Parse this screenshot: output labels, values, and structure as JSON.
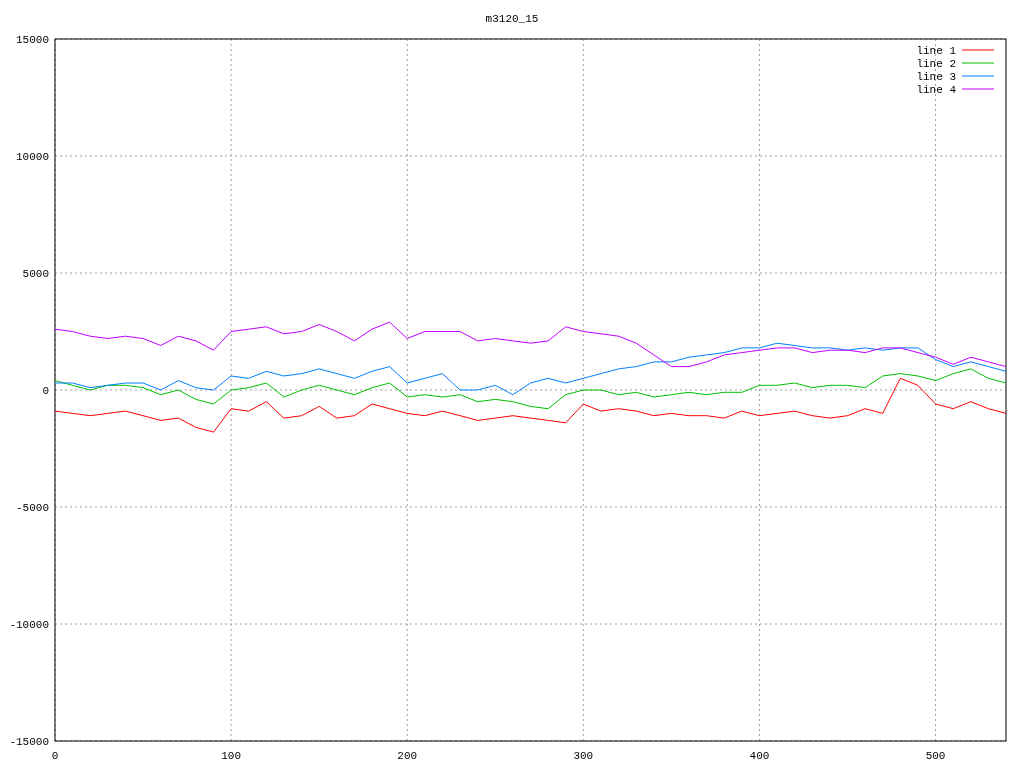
{
  "chart_data": {
    "type": "line",
    "title": "m3120_15",
    "x": [
      0,
      10,
      20,
      30,
      40,
      50,
      60,
      70,
      80,
      90,
      100,
      110,
      120,
      130,
      140,
      150,
      160,
      170,
      180,
      190,
      200,
      210,
      220,
      230,
      240,
      250,
      260,
      270,
      280,
      290,
      300,
      310,
      320,
      330,
      340,
      350,
      360,
      370,
      380,
      390,
      400,
      410,
      420,
      430,
      440,
      450,
      460,
      470,
      480,
      490,
      500,
      510,
      520,
      530,
      540
    ],
    "grid": true,
    "legend": true,
    "xlim": [
      0,
      540
    ],
    "ylim": [
      -15000,
      15000
    ],
    "xticks": [
      0,
      100,
      200,
      300,
      400,
      500
    ],
    "yticks": [
      -15000,
      -10000,
      -5000,
      0,
      5000,
      10000,
      15000
    ],
    "series": [
      {
        "name": "line 1",
        "color": "#ff0000",
        "values": [
          -900,
          -1000,
          -1100,
          -1000,
          -900,
          -1100,
          -1300,
          -1200,
          -1600,
          -1800,
          -800,
          -900,
          -500,
          -1200,
          -1100,
          -700,
          -1200,
          -1100,
          -600,
          -800,
          -1000,
          -1100,
          -900,
          -1100,
          -1300,
          -1200,
          -1100,
          -1200,
          -1300,
          -1400,
          -600,
          -900,
          -800,
          -900,
          -1100,
          -1000,
          -1100,
          -1100,
          -1200,
          -900,
          -1100,
          -1000,
          -900,
          -1100,
          -1200,
          -1100,
          -800,
          -1000,
          500,
          200,
          -600,
          -800,
          -500,
          -800,
          -1000
        ]
      },
      {
        "name": "line 2",
        "color": "#00c000",
        "values": [
          400,
          200,
          0,
          200,
          200,
          100,
          -200,
          0,
          -400,
          -600,
          0,
          100,
          300,
          -300,
          0,
          200,
          0,
          -200,
          100,
          300,
          -300,
          -200,
          -300,
          -200,
          -500,
          -400,
          -500,
          -700,
          -800,
          -200,
          0,
          0,
          -200,
          -100,
          -300,
          -200,
          -100,
          -200,
          -100,
          -100,
          200,
          200,
          300,
          100,
          200,
          200,
          100,
          600,
          700,
          600,
          400,
          700,
          900,
          500,
          300
        ]
      },
      {
        "name": "line 3",
        "color": "#0080ff",
        "values": [
          300,
          300,
          100,
          200,
          300,
          300,
          0,
          400,
          100,
          0,
          600,
          500,
          800,
          600,
          700,
          900,
          700,
          500,
          800,
          1000,
          300,
          500,
          700,
          0,
          0,
          200,
          -200,
          300,
          500,
          300,
          500,
          700,
          900,
          1000,
          1200,
          1200,
          1400,
          1500,
          1600,
          1800,
          1800,
          2000,
          1900,
          1800,
          1800,
          1700,
          1800,
          1700,
          1800,
          1800,
          1300,
          1000,
          1200,
          1000,
          800
        ]
      },
      {
        "name": "line 4",
        "color": "#c000ff",
        "values": [
          2600,
          2500,
          2300,
          2200,
          2300,
          2200,
          1900,
          2300,
          2100,
          1700,
          2500,
          2600,
          2700,
          2400,
          2500,
          2800,
          2500,
          2100,
          2600,
          2900,
          2200,
          2500,
          2500,
          2500,
          2100,
          2200,
          2100,
          2000,
          2100,
          2700,
          2500,
          2400,
          2300,
          2000,
          1500,
          1000,
          1000,
          1200,
          1500,
          1600,
          1700,
          1800,
          1800,
          1600,
          1700,
          1700,
          1600,
          1800,
          1800,
          1600,
          1400,
          1100,
          1400,
          1200,
          1000
        ]
      }
    ]
  }
}
